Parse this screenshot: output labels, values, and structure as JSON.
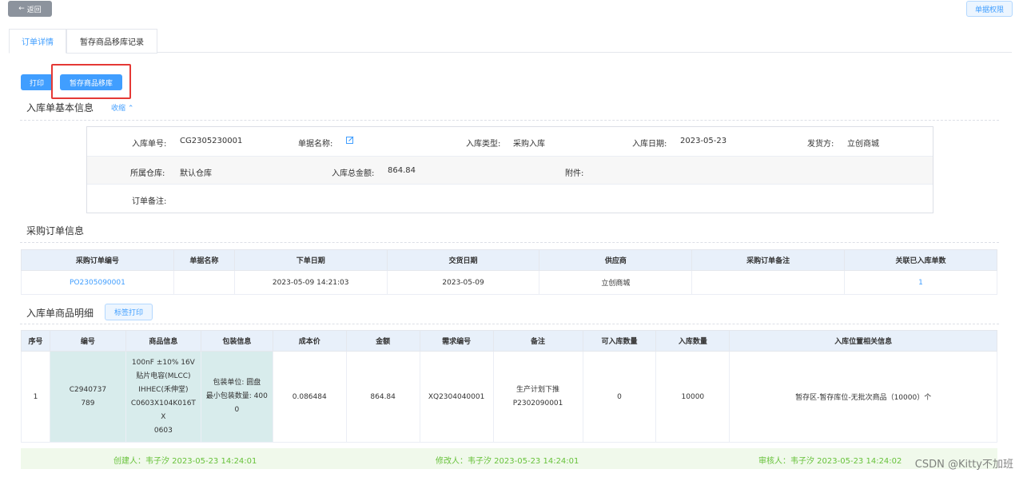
{
  "top": {
    "back_label": "返回",
    "perm_label": "单据权限"
  },
  "tabs": [
    "订单详情",
    "暂存商品移库记录"
  ],
  "actions": {
    "print_label": "打印",
    "move_label": "暂存商品移库"
  },
  "basic": {
    "title": "入库单基本信息",
    "collapse_label": "收缩",
    "order_no_label": "入库单号:",
    "order_no": "CG2305230001",
    "doc_name_label": "单据名称:",
    "type_label": "入库类型:",
    "type": "采购入库",
    "date_label": "入库日期:",
    "date": "2023-05-23",
    "sender_label": "发货方:",
    "sender": "立创商城",
    "warehouse_label": "所属仓库:",
    "warehouse": "默认仓库",
    "total_label": "入库总金额:",
    "total": "864.84",
    "attach_label": "附件:",
    "remark_label": "订单备注:"
  },
  "purchase": {
    "title": "采购订单信息",
    "headers": [
      "采购订单编号",
      "单据名称",
      "下单日期",
      "交货日期",
      "供应商",
      "采购订单备注",
      "关联已入库单数"
    ],
    "row": [
      "PO2305090001",
      "",
      "2023-05-09 14:21:03",
      "2023-05-09",
      "立创商城",
      "",
      "1"
    ]
  },
  "goods": {
    "title": "入库单商品明细",
    "label_print": "标签打印",
    "headers": [
      "序号",
      "编号",
      "商品信息",
      "包装信息",
      "成本价",
      "金额",
      "需求编号",
      "备注",
      "可入库数量",
      "入库数量",
      "入库位置相关信息"
    ],
    "row": {
      "index": "1",
      "code_l1": "C2940737",
      "code_l2": "789",
      "info": [
        "100nF ±10% 16V",
        "贴片电容(MLCC)",
        "IHHEC(禾伸堂)",
        "C0603X104K016T",
        "X",
        "0603"
      ],
      "pack_l1": "包装单位: 圆盘",
      "pack_l2": "最小包装数量: 400",
      "pack_l3": "0",
      "cost": "0.086484",
      "amount": "864.84",
      "demand_no": "XQ2304040001",
      "remark_l1": "生产计划下推",
      "remark_l2": "P2302090001",
      "available_qty": "0",
      "in_qty": "10000",
      "location": "暂存区-暂存库位-无批次商品（10000）个"
    }
  },
  "footer": {
    "creator": "创建人：韦子汐 2023-05-23 14:24:01",
    "modifier": "修改人：韦子汐 2023-05-23 14:24:01",
    "reviewer": "审核人：韦子汐 2023-05-23 14:24:02"
  },
  "watermark": "CSDN @Kitty不加班",
  "colors": {
    "primary": "#409eff",
    "highlight": "#e53935",
    "footer_text": "#67c23a",
    "teal_cell": "#d8ecec"
  }
}
